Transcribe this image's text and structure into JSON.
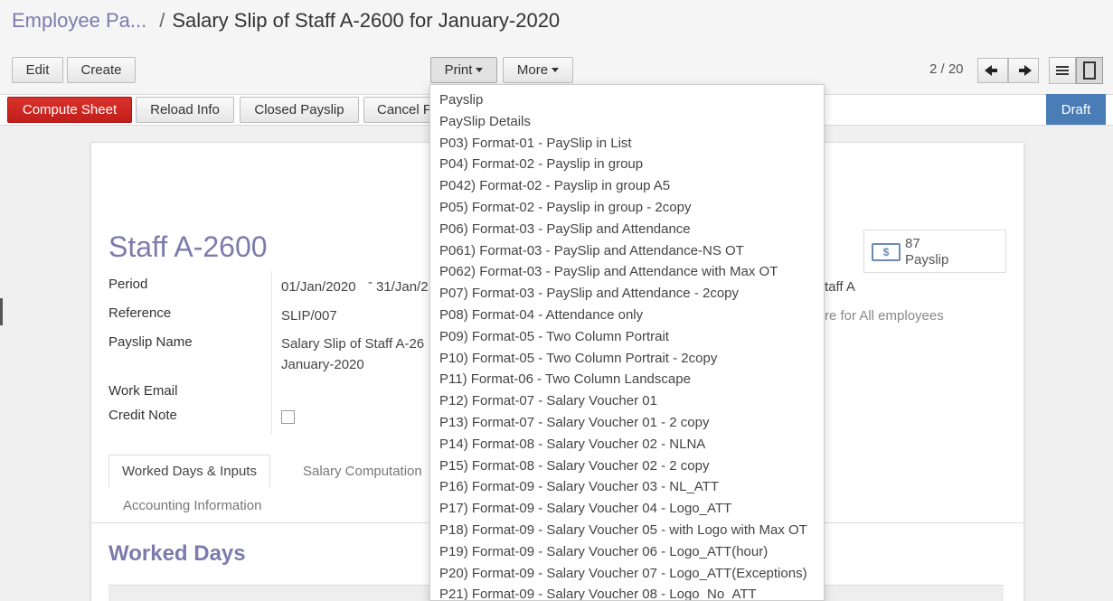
{
  "breadcrumb": {
    "parent": "Employee Pa...",
    "separator": "/",
    "current": "Salary Slip of Staff A-2600 for January-2020"
  },
  "toolbar": {
    "edit": "Edit",
    "create": "Create",
    "print": "Print",
    "more": "More"
  },
  "pager": {
    "value": "2 / 20"
  },
  "status_bar": {
    "buttons": [
      "Compute Sheet",
      "Reload Info",
      "Closed Payslip",
      "Cancel P"
    ],
    "stage": "Draft"
  },
  "form": {
    "title": "Staff A-2600",
    "smart_button": {
      "count": "87",
      "label": "Payslip"
    },
    "labels": {
      "period": "Period",
      "reference": "Reference",
      "payslip_name": "Payslip Name",
      "work_email": "Work Email",
      "credit_note": "Credit Note"
    },
    "values": {
      "period_start": "01/Jan/2020",
      "period_dash": "-",
      "period_end": "31/Jan/2",
      "reference": "SLIP/007",
      "payslip_name_1": "Salary Slip of Staff A-26",
      "payslip_name_2": "January-2020"
    },
    "right_values": {
      "employee_partial": "taff A",
      "structure_partial": "re for All employees"
    },
    "credit_note_checked": false
  },
  "tabs": [
    "Worked Days & Inputs",
    "Salary Computation",
    "Accounting Information"
  ],
  "tab_fragment": "/",
  "section_title": "Worked Days",
  "print_menu": [
    "Payslip",
    "PaySlip Details",
    "P03) Format-01 - PaySlip in List",
    "P04) Format-02 - Payslip in group",
    "P042) Format-02 - Payslip in group A5",
    "P05) Format-02 - Payslip in group - 2copy",
    "P06) Format-03 - PaySlip and Attendance",
    "P061) Format-03 - PaySlip and Attendance-NS OT",
    "P062) Format-03 - PaySlip and Attendance with Max OT",
    "P07) Format-03 - PaySlip and Attendance - 2copy",
    "P08) Format-04 - Attendance only",
    "P09) Format-05 - Two Column Portrait",
    "P10) Format-05 - Two Column Portrait - 2copy",
    "P11) Format-06 - Two Column Landscape",
    "P12) Format-07 - Salary Voucher 01",
    "P13) Format-07 - Salary Voucher 01 - 2 copy",
    "P14) Format-08 - Salary Voucher 02 - NLNA",
    "P15) Format-08 - Salary Voucher 02 - 2 copy",
    "P16) Format-09 - Salary Voucher 03 - NL_ATT",
    "P17) Format-09 - Salary Voucher 04 - Logo_ATT",
    "P18) Format-09 - Salary Voucher 05 - with Logo with Max OT",
    "P19) Format-09 - Salary Voucher 06 - Logo_ATT(hour)",
    "P20) Format-09 - Salary Voucher 07 - Logo_ATT(Exceptions)",
    "P21) Format-09 - Salary Voucher 08 - Logo_No_ATT"
  ],
  "colors": {
    "accent": "#7c7bad",
    "primary_button": "#c9211e",
    "stage": "#4a7db5"
  },
  "icons": [
    "arrow-left-icon",
    "arrow-right-icon",
    "list-view-icon",
    "form-view-icon",
    "money-icon"
  ]
}
